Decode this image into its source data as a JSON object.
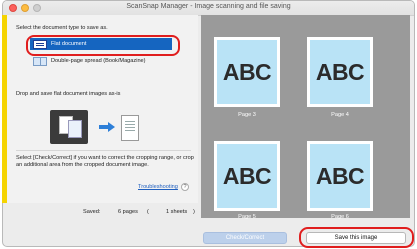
{
  "window": {
    "title": "ScanSnap Manager - Image scanning and file saving"
  },
  "left": {
    "select_heading": "Select the document type to save as.",
    "options": [
      {
        "label": "Flat document",
        "icon": "flat-document-icon",
        "selected": true
      },
      {
        "label": "Double-page spread (Book/Magazine)",
        "icon": "book-icon",
        "selected": false
      }
    ],
    "drop_text": "Drop and save flat document images as-is",
    "check_text": "Select [Check/Correct] if you want to correct the cropping range, or crop an additional area from the cropped document image.",
    "troubleshooting_label": "Troubleshooting",
    "help_label": "?"
  },
  "status": {
    "saved_label": "Saved:",
    "pages_value": "6 pages",
    "open_paren": "(",
    "sheets_value": "1 sheets",
    "close_paren": ")"
  },
  "preview": {
    "pages": [
      {
        "text": "ABC",
        "label": "Page 3"
      },
      {
        "text": "ABC",
        "label": "Page 4"
      },
      {
        "text": "ABC",
        "label": "Page 5"
      },
      {
        "text": "ABC",
        "label": "Page 6"
      }
    ]
  },
  "buttons": {
    "check_correct": "Check/Correct",
    "save_image": "Save this image"
  },
  "colors": {
    "accent_yellow": "#f5d400",
    "selection_blue": "#1565c0",
    "highlight_red": "#e01e1e",
    "page_fill": "#b9e3f6"
  }
}
